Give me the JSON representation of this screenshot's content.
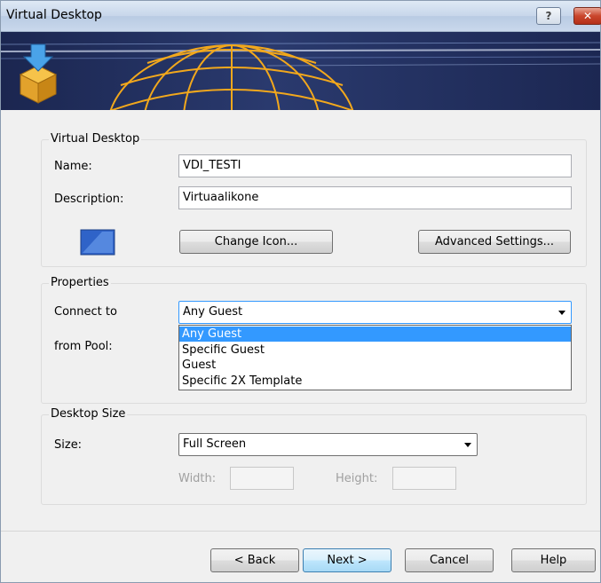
{
  "window": {
    "title": "Virtual Desktop",
    "help_button": "?",
    "close_button": "✕"
  },
  "virtual_desktop_group": {
    "title": "Virtual Desktop",
    "name_label": "Name:",
    "name_value": "VDI_TESTI",
    "description_label": "Description:",
    "description_value": "Virtuaalikone",
    "change_icon_button": "Change Icon...",
    "advanced_settings_button": "Advanced Settings..."
  },
  "properties_group": {
    "title": "Properties",
    "connect_to_label": "Connect to",
    "connect_to_value": "Any Guest",
    "from_pool_label": "from Pool:",
    "options": [
      "Any Guest",
      "Specific Guest",
      "Guest",
      "Specific 2X Template"
    ],
    "selected_option": "Any Guest"
  },
  "desktop_size_group": {
    "title": "Desktop Size",
    "size_label": "Size:",
    "size_value": "Full Screen",
    "width_label": "Width:",
    "height_label": "Height:"
  },
  "footer": {
    "back_button": "< Back",
    "next_button": "Next >",
    "cancel_button": "Cancel",
    "help_button": "Help"
  },
  "icons": [
    "help-icon",
    "close-icon",
    "install-box-icon",
    "globe-logo",
    "desktop-icon",
    "chevron-down-icon"
  ]
}
